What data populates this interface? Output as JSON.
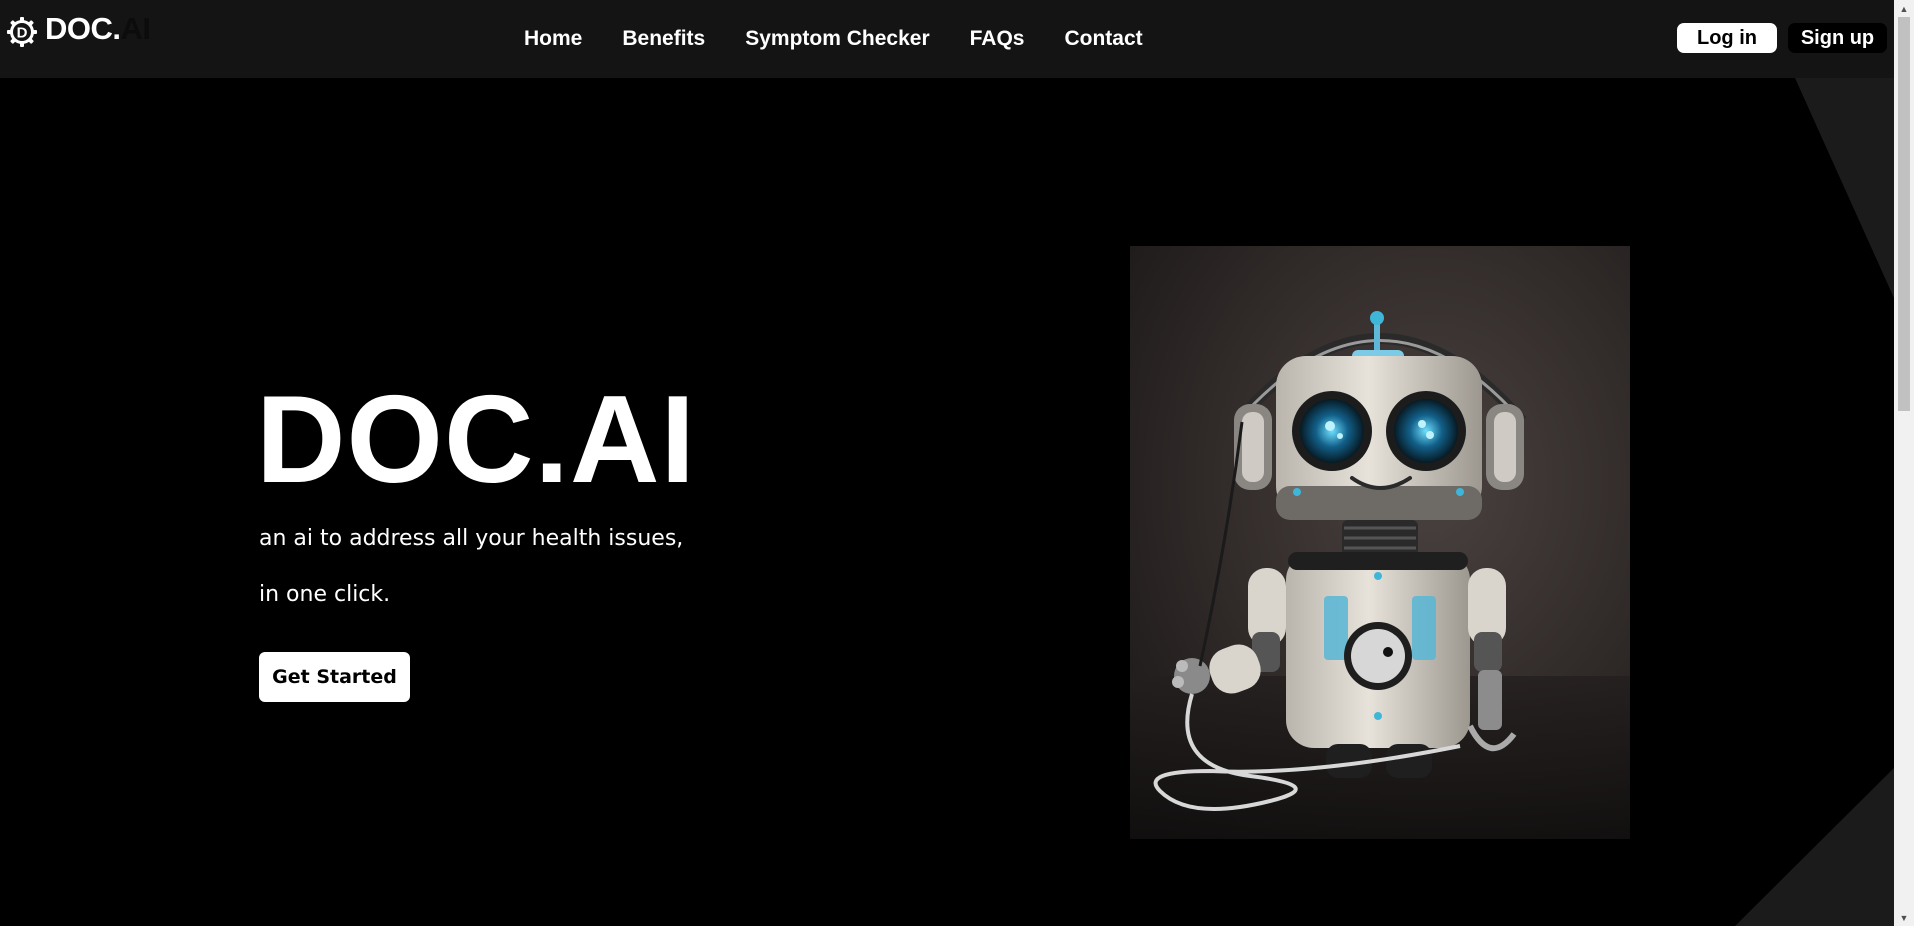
{
  "brand": {
    "name_primary": "DOC.",
    "name_secondary": "AI",
    "logo_letter": "D"
  },
  "nav": {
    "items": [
      {
        "label": "Home"
      },
      {
        "label": "Benefits"
      },
      {
        "label": "Symptom Checker"
      },
      {
        "label": "FAQs"
      },
      {
        "label": "Contact"
      }
    ]
  },
  "auth": {
    "login_label": "Log in",
    "signup_label": "Sign up"
  },
  "hero": {
    "title": "DOC.AI",
    "tagline_line1": "an ai to address all your health issues,",
    "tagline_line2": "in one click.",
    "cta_label": "Get Started",
    "image_subject": "robot-doctor-with-headphones-and-stethoscope"
  },
  "colors": {
    "page_bg": "#000000",
    "navbar_bg": "#141414",
    "text": "#ffffff",
    "button_bg": "#ffffff",
    "shape_gray": "#1c1c1c",
    "robot_accent": "#3fb6d8"
  },
  "icons": {
    "logo": "gear-logo-icon",
    "scroll_up": "chevron-up-icon",
    "scroll_down": "chevron-down-icon"
  }
}
